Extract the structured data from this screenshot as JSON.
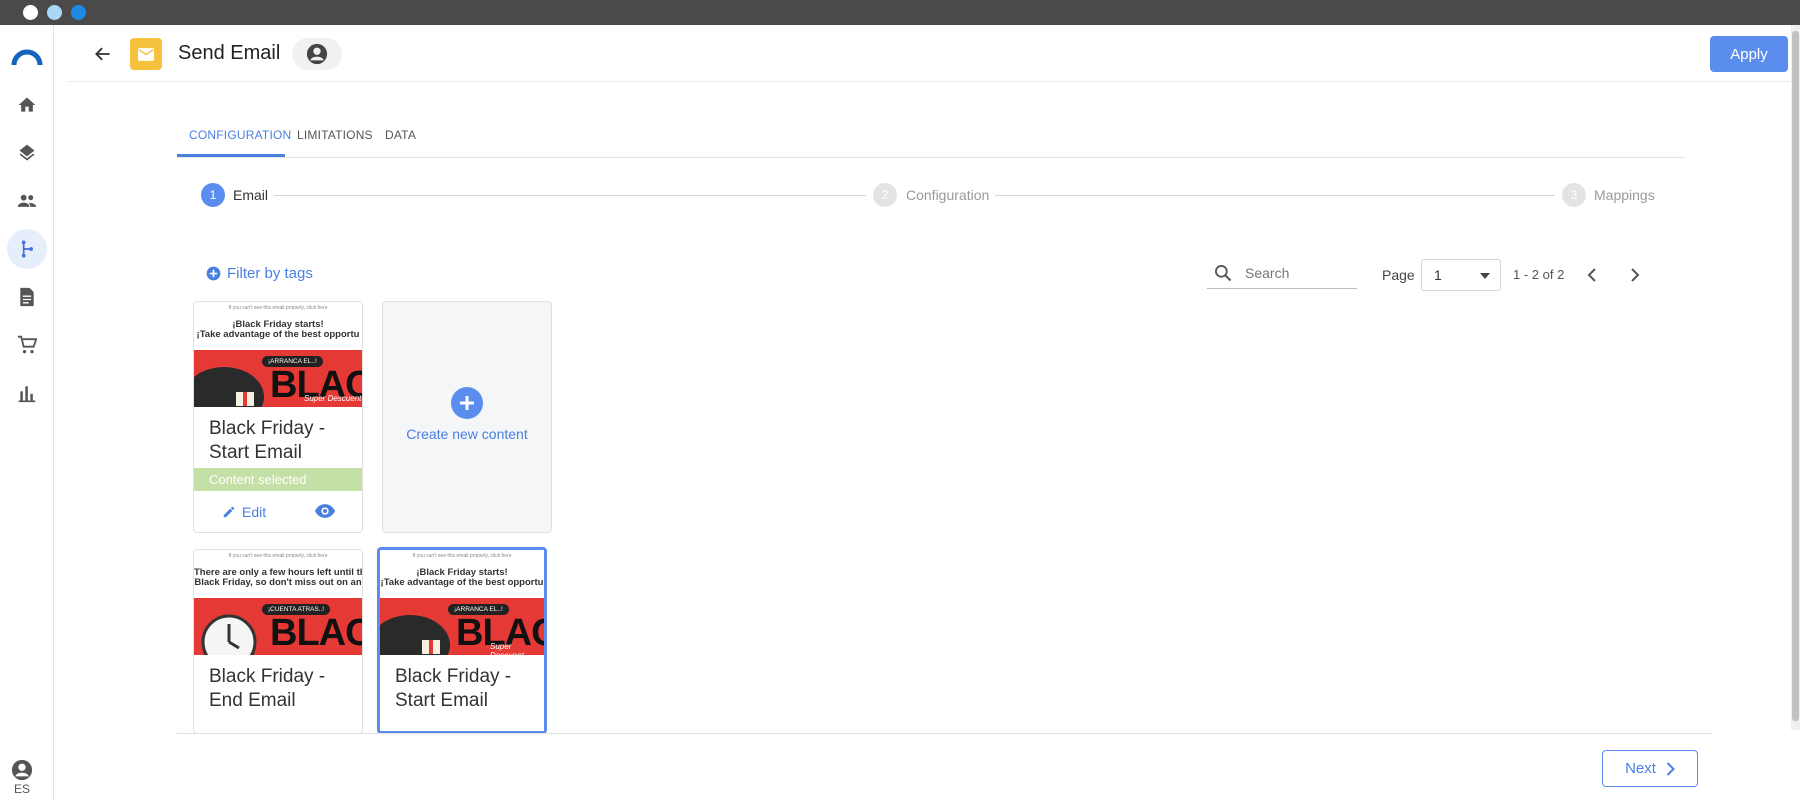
{
  "window": {
    "dots": [
      "#ffffff",
      "#a9d8f5",
      "#1e88e5"
    ]
  },
  "sidebar": {
    "items": [
      {
        "icon": "home-icon"
      },
      {
        "icon": "layers-icon"
      },
      {
        "icon": "people-icon"
      },
      {
        "icon": "flow-icon",
        "active": true
      },
      {
        "icon": "document-icon"
      },
      {
        "icon": "cart-icon"
      },
      {
        "icon": "bar-chart-icon"
      }
    ],
    "language": "ES"
  },
  "header": {
    "title": "Send Email",
    "apply_label": "Apply"
  },
  "tabs": [
    {
      "label": "CONFIGURATION",
      "active": true
    },
    {
      "label": "LIMITATIONS",
      "active": false
    },
    {
      "label": "DATA",
      "active": false
    }
  ],
  "stepper": [
    {
      "number": "1",
      "label": "Email",
      "active": true
    },
    {
      "number": "2",
      "label": "Configuration",
      "active": false
    },
    {
      "number": "3",
      "label": "Mappings",
      "active": false
    }
  ],
  "toolbar": {
    "filter_label": "Filter by tags",
    "search_placeholder": "Search",
    "page_label": "Page",
    "page_value": "1",
    "range_label": "1 - 2 of 2"
  },
  "cards": [
    {
      "title": "Black Friday - Start Email",
      "thumb_top": "If you can't see this email properly, click here",
      "thumb_line1": "¡Black Friday starts!",
      "thumb_line2": "¡Take advantage of the best opportu",
      "banner_pill": "¡ARRANCA EL..!",
      "banner_word": "BLAC",
      "banner_sub": "Super Descuent",
      "selected_label": "Content selected",
      "edit_label": "Edit"
    },
    {
      "title": "Black Friday - End Email",
      "thumb_top": "If you can't see this email properly, click here",
      "thumb_line1": "There are only a few hours left until th",
      "thumb_line2": "Black Friday, so don't miss out on an",
      "banner_pill": "¡CUENTA ATRAS..!",
      "banner_word": "BLAC"
    },
    {
      "title": "Black Friday - Start Email",
      "thumb_top": "If you can't see this email properly, click here",
      "thumb_line1": "¡Black Friday starts!",
      "thumb_line2": "¡Take advantage of the best opportu",
      "banner_pill": "¡ARRANCA EL..!",
      "banner_word": "BLAC",
      "banner_sub": "Super Descuent"
    }
  ],
  "create_card": {
    "label": "Create new content"
  },
  "footer": {
    "next_label": "Next"
  },
  "colors": {
    "accent": "#5b8def",
    "selected_bar": "#c4e0a6",
    "app_icon": "#f6c23e"
  }
}
